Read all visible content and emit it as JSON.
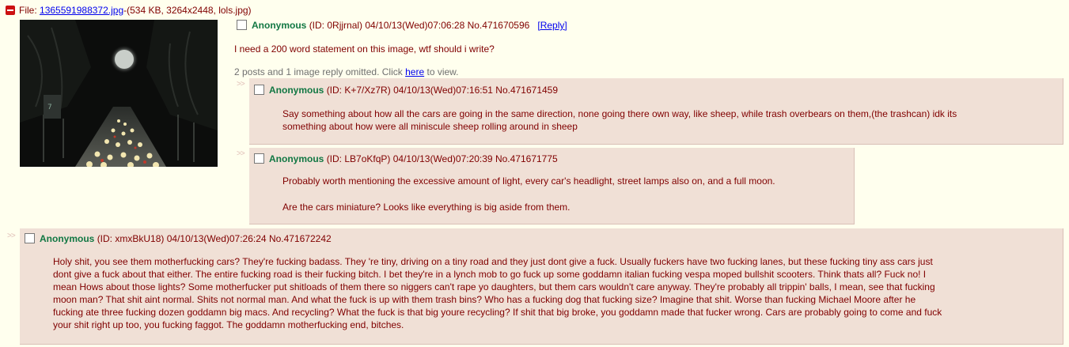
{
  "op": {
    "file_label": "File:",
    "file_link": "1365591988372.jpg",
    "file_info": "-(534 KB, 3264x2448, lols.jpg)",
    "name": "Anonymous",
    "id": "(ID: 0Rjjrnal)",
    "datetime": "04/10/13(Wed)07:06:28",
    "post_no": "No.471670596",
    "reply_label": "[Reply]",
    "message": "I need a 200 word statement on this image, wtf should i write?",
    "omitted_text": "2 posts and 1 image reply omitted. Click",
    "omitted_link": "here",
    "omitted_suffix": "to view."
  },
  "replies": [
    {
      "arrows": ">>",
      "name": "Anonymous",
      "id": "(ID: K+7/Xz7R)",
      "datetime": "04/10/13(Wed)07:16:51",
      "post_no": "No.471671459",
      "message": [
        "Say something about how all the cars are going in the same direction, none going there own way, like sheep, while trash overbears on them,(the trashcan) idk its",
        "something about how were all miniscule sheep rolling around in sheep"
      ]
    },
    {
      "arrows": ">>",
      "name": "Anonymous",
      "id": "(ID: LB7oKfqP)",
      "datetime": "04/10/13(Wed)07:20:39",
      "post_no": "No.471671775",
      "message": [
        "Probably worth mentioning the excessive amount of light, every car's headlight, street lamps also on, and a full moon.",
        "Are the cars miniature? Looks like everything is big aside from them."
      ]
    },
    {
      "arrows": ">>",
      "name": "Anonymous",
      "id": "(ID: xmxBkU18)",
      "datetime": "04/10/13(Wed)07:26:24",
      "post_no": "No.471672242",
      "message": [
        "Holy shit, you see them motherfucking cars? They're fucking badass. They 're tiny, driving on a tiny road and they just dont give a fuck. Usually fuckers have two fucking lanes, but these fucking tiny ass cars just",
        "dont give a fuck about that either. The entire fucking road is their fucking bitch. I bet they're in a lynch mob to go fuck up some goddamn italian fucking vespa moped bullshit scooters. Think thats all? Fuck no! I",
        "mean Hows about those lights? Some motherfucker put shitloads of them there so niggers can't rape yo daughters, but them cars wouldn't care anyway. They're probably all trippin' balls, I mean, see that fucking",
        "moon man? That shit aint normal. Shits not normal man. And what the fuck is up with them trash bins? Who has a fucking dog that fucking size? Imagine that shit. Worse than fucking Michael Moore after he",
        "fucking ate three fucking dozen goddamn big macs. And recycling? What the fuck is that big youre recycling? If shit that big broke, you goddamn made that fucker wrong. Cars are probably going to come and fuck",
        "your shit right up too, you fucking faggot. The goddamn motherfucking end, bitches."
      ]
    }
  ],
  "colors": {
    "background": "#ffffee",
    "reply_bg": "#f0e0d6",
    "name": "#117743",
    "text": "#800000",
    "link": "#0000ee",
    "hide_button": "#cc1111"
  },
  "icons": [
    "minus-icon",
    "checkbox-icon"
  ]
}
